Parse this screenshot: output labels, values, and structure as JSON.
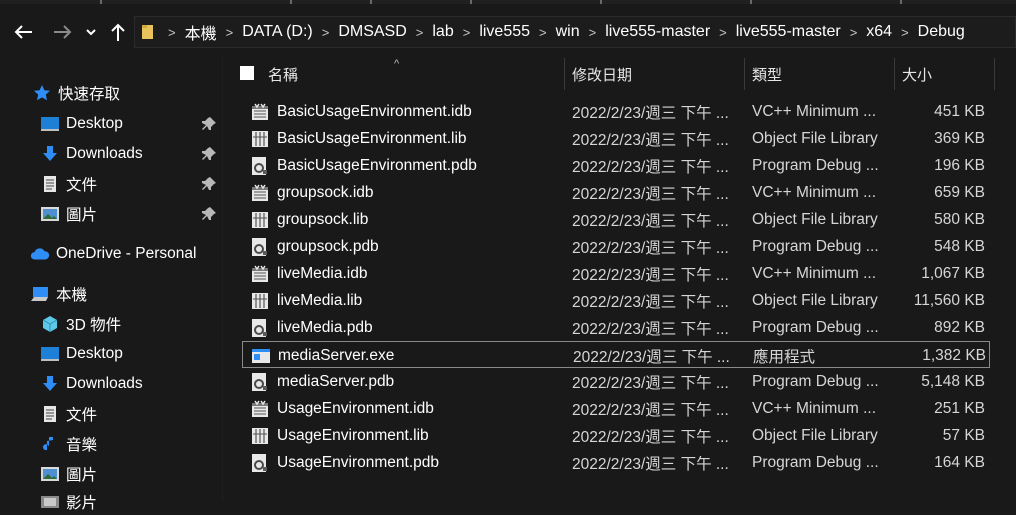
{
  "nav": {
    "back_icon": "arrow-left-icon",
    "forward_icon": "arrow-right-icon",
    "recent_icon": "chevron-down-icon",
    "up_icon": "arrow-up-icon"
  },
  "breadcrumb": [
    "本機",
    "DATA (D:)",
    "DMSASD",
    "lab",
    "live555",
    "win",
    "live555-master",
    "live555-master",
    "x64",
    "Debug"
  ],
  "sidebar": {
    "quick_access": "快速存取",
    "quick_items": [
      {
        "label": "Desktop",
        "icon": "desktop-icon"
      },
      {
        "label": "Downloads",
        "icon": "download-icon"
      },
      {
        "label": "文件",
        "icon": "document-icon"
      },
      {
        "label": "圖片",
        "icon": "picture-icon"
      }
    ],
    "onedrive": "OneDrive - Personal",
    "this_pc": "本機",
    "pc_items": [
      {
        "label": "3D 物件",
        "icon": "cube-icon"
      },
      {
        "label": "Desktop",
        "icon": "desktop-icon"
      },
      {
        "label": "Downloads",
        "icon": "download-icon"
      },
      {
        "label": "文件",
        "icon": "document-icon"
      },
      {
        "label": "音樂",
        "icon": "music-icon"
      },
      {
        "label": "圖片",
        "icon": "picture-icon"
      },
      {
        "label": "影片",
        "icon": "video-icon"
      }
    ]
  },
  "columns": {
    "name": "名稱",
    "date": "修改日期",
    "type": "類型",
    "size": "大小"
  },
  "files": [
    {
      "name": "BasicUsageEnvironment.idb",
      "date": "2022/2/23/週三 下午 ...",
      "type": "VC++ Minimum ...",
      "size": "451 KB",
      "icon": "idb-file-icon"
    },
    {
      "name": "BasicUsageEnvironment.lib",
      "date": "2022/2/23/週三 下午 ...",
      "type": "Object File Library",
      "size": "369 KB",
      "icon": "lib-file-icon"
    },
    {
      "name": "BasicUsageEnvironment.pdb",
      "date": "2022/2/23/週三 下午 ...",
      "type": "Program Debug ...",
      "size": "196 KB",
      "icon": "pdb-file-icon"
    },
    {
      "name": "groupsock.idb",
      "date": "2022/2/23/週三 下午 ...",
      "type": "VC++ Minimum ...",
      "size": "659 KB",
      "icon": "idb-file-icon"
    },
    {
      "name": "groupsock.lib",
      "date": "2022/2/23/週三 下午 ...",
      "type": "Object File Library",
      "size": "580 KB",
      "icon": "lib-file-icon"
    },
    {
      "name": "groupsock.pdb",
      "date": "2022/2/23/週三 下午 ...",
      "type": "Program Debug ...",
      "size": "548 KB",
      "icon": "pdb-file-icon"
    },
    {
      "name": "liveMedia.idb",
      "date": "2022/2/23/週三 下午 ...",
      "type": "VC++ Minimum ...",
      "size": "1,067 KB",
      "icon": "idb-file-icon"
    },
    {
      "name": "liveMedia.lib",
      "date": "2022/2/23/週三 下午 ...",
      "type": "Object File Library",
      "size": "11,560 KB",
      "icon": "lib-file-icon"
    },
    {
      "name": "liveMedia.pdb",
      "date": "2022/2/23/週三 下午 ...",
      "type": "Program Debug ...",
      "size": "892 KB",
      "icon": "pdb-file-icon"
    },
    {
      "name": "mediaServer.exe",
      "date": "2022/2/23/週三 下午 ...",
      "type": "應用程式",
      "size": "1,382 KB",
      "icon": "exe-file-icon",
      "selected": true
    },
    {
      "name": "mediaServer.pdb",
      "date": "2022/2/23/週三 下午 ...",
      "type": "Program Debug ...",
      "size": "5,148 KB",
      "icon": "pdb-file-icon"
    },
    {
      "name": "UsageEnvironment.idb",
      "date": "2022/2/23/週三 下午 ...",
      "type": "VC++ Minimum ...",
      "size": "251 KB",
      "icon": "idb-file-icon"
    },
    {
      "name": "UsageEnvironment.lib",
      "date": "2022/2/23/週三 下午 ...",
      "type": "Object File Library",
      "size": "57 KB",
      "icon": "lib-file-icon"
    },
    {
      "name": "UsageEnvironment.pdb",
      "date": "2022/2/23/週三 下午 ...",
      "type": "Program Debug ...",
      "size": "164 KB",
      "icon": "pdb-file-icon"
    }
  ],
  "colors": {
    "background": "#191919",
    "accent_blue": "#2f8ef5",
    "folder_yellow": "#e8c25a",
    "text": "#ffffff"
  }
}
